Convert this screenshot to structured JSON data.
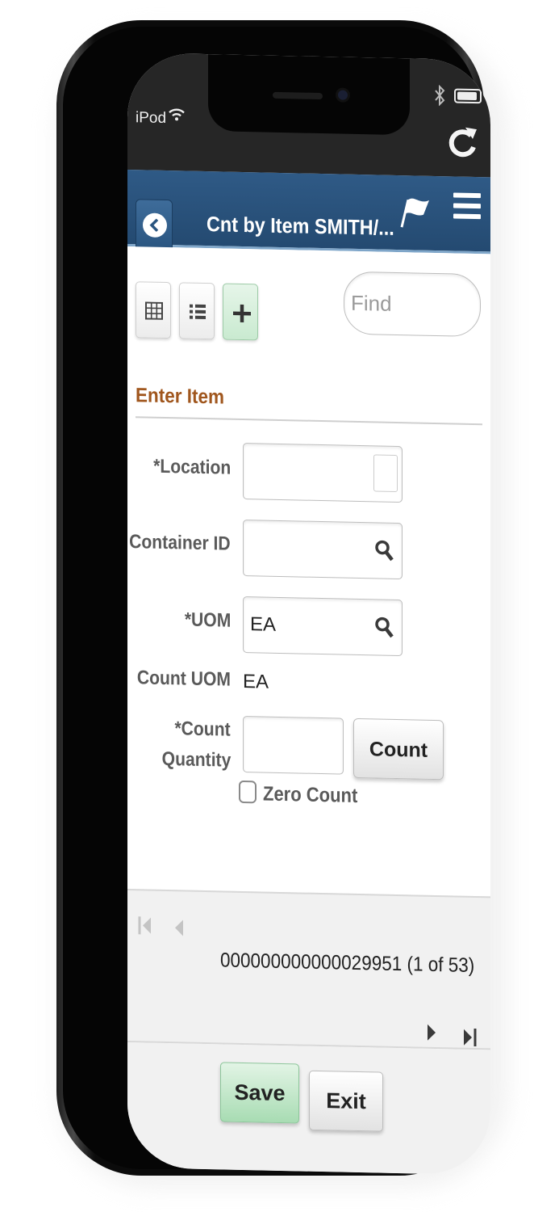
{
  "status_bar": {
    "carrier": "iPod",
    "icons": [
      "wifi-icon",
      "bluetooth-icon",
      "battery-icon",
      "reload-icon"
    ]
  },
  "header": {
    "title": "Cnt by Item SMITH/...",
    "back_icon": "chevron-left-icon",
    "flag_icon": "flag-icon",
    "menu_icon": "hamburger-menu-icon",
    "color": "#2a5580"
  },
  "toolbar": {
    "buttons": [
      {
        "icon": "grid-view-icon"
      },
      {
        "icon": "list-view-icon"
      },
      {
        "icon": "plus-icon"
      }
    ],
    "find_placeholder": "Find"
  },
  "form": {
    "section_title": "Enter Item",
    "section_title_color": "#a0561d",
    "location_label": "*Location",
    "location_value": "",
    "container_label": "Container ID",
    "container_value": "",
    "uom_label": "*UOM",
    "uom_value": "EA",
    "count_uom_label": "Count UOM",
    "count_uom_value": "EA",
    "count_qty_label_line1": "*Count",
    "count_qty_label_line2": "Quantity",
    "count_qty_value": "",
    "count_button": "Count",
    "zero_count_label": "Zero Count",
    "zero_count_checked": false
  },
  "pager": {
    "record_text": "000000000000029951 (1 of 53)"
  },
  "footer": {
    "save_label": "Save",
    "exit_label": "Exit",
    "save_color": "#a8dcb3"
  }
}
